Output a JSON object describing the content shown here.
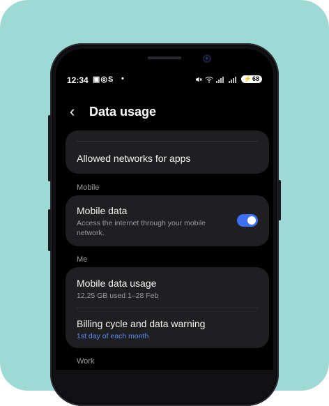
{
  "status_bar": {
    "time": "12:34",
    "icons_left": "▣◎S",
    "dot": "•",
    "battery": "68"
  },
  "header": {
    "back_glyph": "‹",
    "title": "Data usage"
  },
  "settings": {
    "allowed_networks": "Allowed networks for apps",
    "section_mobile": "Mobile",
    "mobile_data": {
      "title": "Mobile data",
      "subtitle": "Access the internet through your mobile network.",
      "enabled": true
    },
    "section_me": "Me",
    "mobile_data_usage": {
      "title": "Mobile data usage",
      "subtitle": "12,25 GB used 1–28 Feb"
    },
    "billing_cycle": {
      "title": "Billing cycle and data warning",
      "subtitle": "1st day of each month"
    },
    "section_work": "Work"
  },
  "colors": {
    "background": "#9fd9d6",
    "accent": "#3e6ff2",
    "link": "#5a8df5"
  }
}
